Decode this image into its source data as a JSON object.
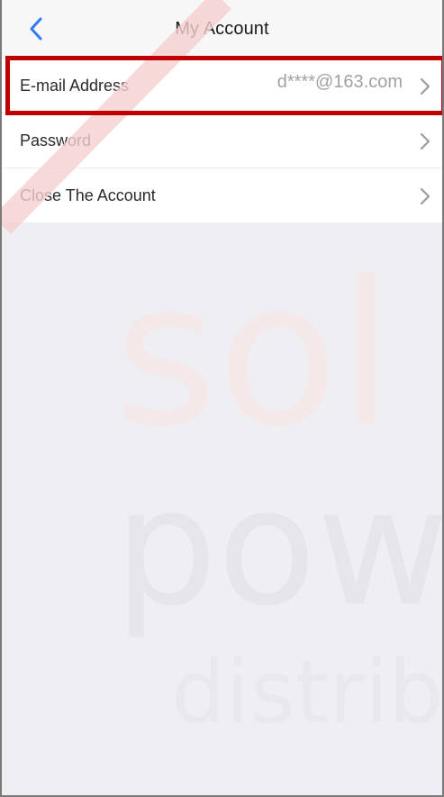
{
  "header": {
    "title": "My Account",
    "back_icon": "chevron-left-icon"
  },
  "account_rows": [
    {
      "label": "E-mail Address",
      "value": "d****@163.com",
      "highlighted": true
    },
    {
      "label": "Password",
      "value": ""
    },
    {
      "label": "Close The Account",
      "value": ""
    }
  ],
  "colors": {
    "accent": "#2f7cf6",
    "highlight": "#c00000",
    "background": "#eeeef3"
  },
  "watermark": {
    "lines": [
      "sol",
      "pow",
      "distrib"
    ]
  }
}
